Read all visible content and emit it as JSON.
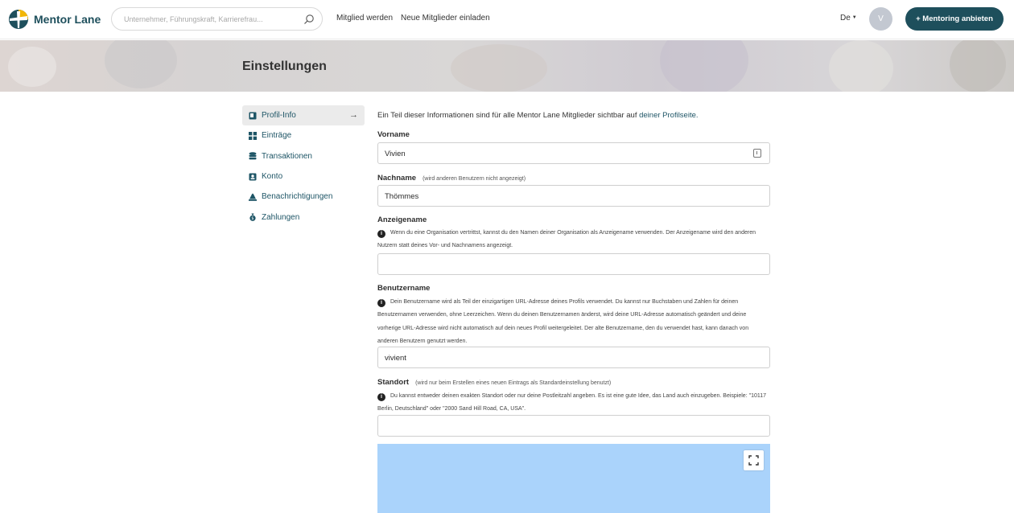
{
  "header": {
    "logo_text": "Mentor Lane",
    "search_placeholder": "Unternehmer, Führungskraft, Karrierefrau...",
    "nav": [
      "Mitglied werden",
      "Neue Mitglieder einladen"
    ],
    "language": "De",
    "avatar_initial": "V",
    "cta_label": "+ Mentoring anbieten"
  },
  "page_title": "Einstellungen",
  "sidebar": {
    "items": [
      {
        "label": "Profil-Info",
        "icon": "profile-card-icon",
        "active": true
      },
      {
        "label": "Einträge",
        "icon": "grid-icon"
      },
      {
        "label": "Transaktionen",
        "icon": "stack-icon"
      },
      {
        "label": "Konto",
        "icon": "account-icon"
      },
      {
        "label": "Benachrichtigungen",
        "icon": "bell-icon"
      },
      {
        "label": "Zahlungen",
        "icon": "money-bag-icon"
      }
    ],
    "active_arrow": "→"
  },
  "form": {
    "intro_text": "Ein Teil dieser Informationen sind für alle Mentor Lane Mitglieder sichtbar auf ",
    "intro_link": "deiner Profilseite.",
    "vorname": {
      "label": "Vorname",
      "value": "Vivien"
    },
    "nachname": {
      "label": "Nachname",
      "hint": "(wird anderen Benutzern nicht angezeigt)",
      "value": "Thömmes"
    },
    "anzeigename": {
      "label": "Anzeigename",
      "help": "Wenn du eine Organisation vertrittst, kannst du den Namen deiner Organisation als Anzeigename verwenden. Der Anzeigename wird den anderen Nutzern statt deines Vor- und Nachnamens angezeigt.",
      "value": ""
    },
    "benutzername": {
      "label": "Benutzername",
      "help": "Dein Benutzername wird als Teil der einzigartigen URL-Adresse deines Profils verwendet. Du kannst nur Buchstaben und Zahlen für deinen Benutzernamen verwenden, ohne Leerzeichen. Wenn du deinen Benutzernamen änderst, wird deine URL-Adresse automatisch geändert und deine vorherige URL-Adresse wird nicht automatisch auf dein neues Profil weitergeleitet. Der alte Benutzername, den du verwendet hast, kann danach von anderen Benutzern genutzt werden.",
      "value": "vivient"
    },
    "standort": {
      "label": "Standort",
      "hint": "(wird nur beim Erstellen eines neuen Eintrags als Standardeinstellung benutzt)",
      "help": "Du kannst entweder deinen exakten Standort oder nur deine Postleitzahl angeben. Es ist eine gute Idee, das Land auch einzugeben. Beispiele: \"10117 Berlin, Deutschland\" oder \"2000 Sand Hill Road, CA, USA\".",
      "value": ""
    },
    "info_glyph": "i"
  },
  "colors": {
    "brand": "#1e4f5c",
    "link": "#1e5566",
    "map_water": "#aad3fb"
  }
}
